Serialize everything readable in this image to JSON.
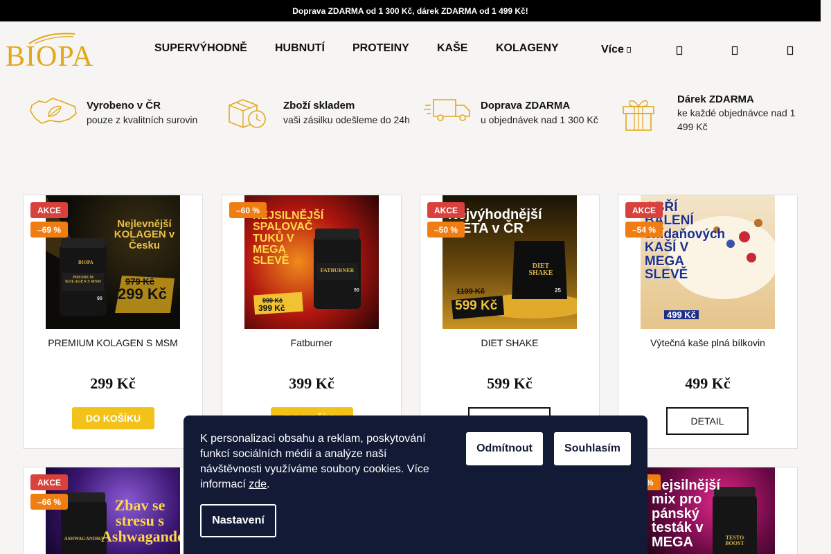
{
  "topbar": {
    "text": "Doprava ZDARMA od 1 300 Kč, dárek ZDARMA od 1 499 Kč!"
  },
  "header": {
    "logo": "BIOPA",
    "nav": [
      "SUPERVÝHODNĚ",
      "HUBNUTÍ",
      "PROTEINY",
      "KAŠE",
      "KOLAGENY"
    ],
    "more": "Více",
    "icons": [
      "search-icon",
      "user-icon",
      "cart-icon"
    ]
  },
  "benefits": [
    {
      "icon": "czech-map-icon",
      "title": "Vyrobeno v ČR",
      "sub": "pouze z kvalitních surovin"
    },
    {
      "icon": "box-clock-icon",
      "title": "Zboží skladem",
      "sub": "vaši zásilku odešleme do 24h"
    },
    {
      "icon": "truck-icon",
      "title": "Doprava ZDARMA",
      "sub": "u objednávek nad 1 300 Kč"
    },
    {
      "icon": "gift-icon",
      "title": "Dárek ZDARMA",
      "sub": "ke každé objednávce nad 1 499 Kč"
    }
  ],
  "products": [
    {
      "name": "PREMIUM KOLAGEN S MSM",
      "price": "299 Kč",
      "akce": "AKCE",
      "discount": "–69 %",
      "button": "DO KOŠÍKU",
      "img": {
        "headline": "Nejlevnější KOLAGEN v Česku",
        "old_price": "979 Kč",
        "new_price": "299 Kč",
        "label": "PREMIUM KOLAGEN S MSM",
        "brand": "BIOPA",
        "count": "90"
      }
    },
    {
      "name": "Fatburner",
      "price": "399 Kč",
      "discount": "–60 %",
      "button": "DO KOŠÍKU",
      "img": {
        "headline": "NEJSILNĚJŠÍ SPALOVAČ TUKŮ V MEGA SLEVĚ",
        "old_price": "999 Kč",
        "new_price": "399 Kč",
        "label": "FATBURNER",
        "count": "90"
      }
    },
    {
      "name": "DIET SHAKE",
      "price": "599 Kč",
      "akce": "AKCE",
      "discount": "–50 %",
      "button": "DETAIL",
      "img": {
        "headline": "Nejvýhodnější DIETA v ČR",
        "old_price": "1199 Kč",
        "new_price": "599 Kč",
        "label": "DIET SHAKE",
        "count": "25"
      }
    },
    {
      "name": "Výtečná kaše plná bílkovin",
      "price": "499 Kč",
      "akce": "AKCE",
      "discount": "–54 %",
      "button": "DETAIL",
      "img": {
        "headline": "OBŘÍ BALENÍ snídaňových KAŠÍ V MEGA SLEVĚ",
        "new_price": "499 Kč"
      }
    },
    {
      "akce": "AKCE",
      "discount": "–66 %",
      "img": {
        "headline": "Zbav se stresu s Ashwagandou",
        "label": "ASHWAGANDHA"
      }
    },
    {
      "discount": "%",
      "img": {
        "headline": "Nejsilnější mix pro pánský testák v MEGA",
        "label": "TESTO BOOST"
      }
    }
  ],
  "cookie": {
    "text_before": "K personalizaci obsahu a reklam, poskytování funkcí sociálních médií a analýze naší návštěvnosti využíváme soubory cookies. Více informací ",
    "link": "zde",
    "text_after": ".",
    "decline": "Odmítnout",
    "accept": "Souhlasím",
    "settings": "Nastavení"
  },
  "colors": {
    "accent": "#f2c21b",
    "akce": "#d9413c",
    "discount": "#ef7d12",
    "cookie_bg": "#121a35",
    "logo": "#e3a81a"
  }
}
